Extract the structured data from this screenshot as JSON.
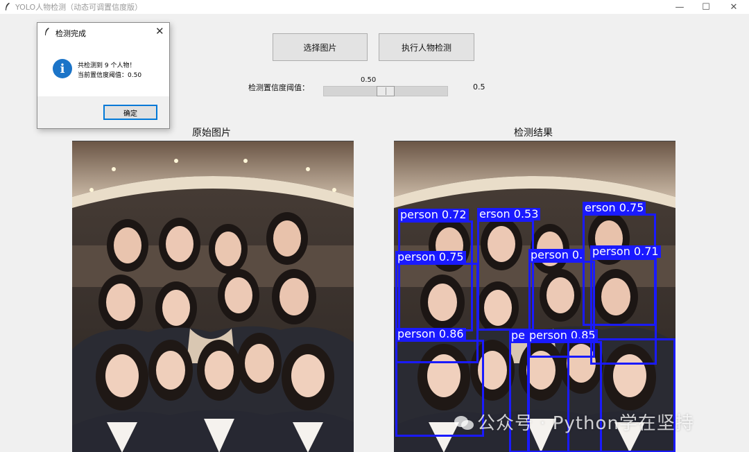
{
  "window": {
    "title": "YOLO人物检测（动态可调置信度版）",
    "minimize_symbol": "—",
    "maximize_symbol": "☐",
    "close_symbol": "✕"
  },
  "toolbar": {
    "select_image_label": "选择图片",
    "detect_label": "执行人物检测"
  },
  "threshold": {
    "label": "检测置信度阈值：",
    "slider_value_text": "0.50",
    "value_fraction": 0.5,
    "right_value": "0.5"
  },
  "panels": {
    "original_title": "原始图片",
    "result_title": "检测结果"
  },
  "detections": [
    {
      "label": "person 0.72"
    },
    {
      "label": "erson 0.53"
    },
    {
      "label": "person 0.75"
    },
    {
      "label": "erson 0.75"
    },
    {
      "label": "person 0."
    },
    {
      "label": "person 0.71"
    },
    {
      "label": "person 0.86"
    },
    {
      "label": "pe"
    },
    {
      "label": "person 0.85"
    }
  ],
  "watermark": {
    "text": "公众号 · Python学在坚持"
  },
  "dialog": {
    "title": "检测完成",
    "close_symbol": "✕",
    "icon_glyph": "i",
    "message_line1": "共检测到 9 个人物！",
    "message_line2": "当前置信度阈值：0.50",
    "ok_label": "确定"
  },
  "colors": {
    "box": "#1a1aff",
    "info_icon": "#1b74c8",
    "ok_focus": "#0078d7"
  }
}
